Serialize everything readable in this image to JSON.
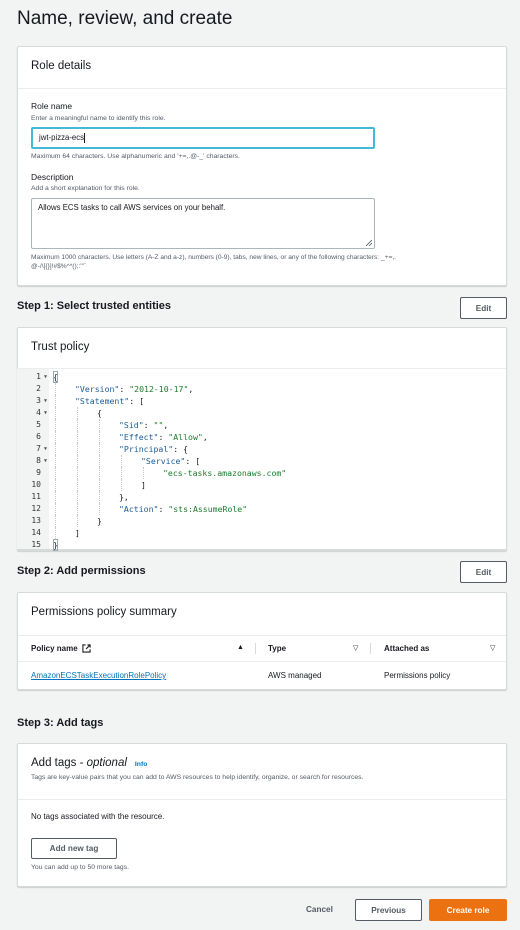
{
  "page": {
    "title": "Name, review, and create"
  },
  "role_details": {
    "header": "Role details",
    "role_name": {
      "label": "Role name",
      "hint": "Enter a meaningful name to identify this role.",
      "value": "jwt-pizza-ecs",
      "constraint": "Maximum 64 characters. Use alphanumeric and '+=,.@-_' characters."
    },
    "description": {
      "label": "Description",
      "hint": "Add a short explanation for this role.",
      "value": "Allows ECS tasks to call AWS services on your behalf.",
      "constraint_line1": "Maximum 1000 characters. Use letters (A-Z and a-z), numbers (0-9), tabs, new lines, or any of the following characters: _+=,.",
      "constraint_line2": "@-/\\[{}]!#$%^*();:\"'`"
    }
  },
  "step1": {
    "title": "Step 1: Select trusted entities",
    "edit_label": "Edit"
  },
  "trust_policy": {
    "header": "Trust policy",
    "lines": [
      {
        "n": "1",
        "fold": true
      },
      {
        "n": "2",
        "fold": false
      },
      {
        "n": "3",
        "fold": true
      },
      {
        "n": "4",
        "fold": true
      },
      {
        "n": "5",
        "fold": false
      },
      {
        "n": "6",
        "fold": false
      },
      {
        "n": "7",
        "fold": true
      },
      {
        "n": "8",
        "fold": true
      },
      {
        "n": "9",
        "fold": false
      },
      {
        "n": "10",
        "fold": false
      },
      {
        "n": "11",
        "fold": false
      },
      {
        "n": "12",
        "fold": false
      },
      {
        "n": "13",
        "fold": false
      },
      {
        "n": "14",
        "fold": false
      },
      {
        "n": "15",
        "fold": false
      }
    ],
    "tokens": {
      "version_key": "\"Version\"",
      "version_val": "\"2012-10-17\"",
      "statement_key": "\"Statement\"",
      "sid_key": "\"Sid\"",
      "sid_val": "\"\"",
      "effect_key": "\"Effect\"",
      "effect_val": "\"Allow\"",
      "principal_key": "\"Principal\"",
      "service_key": "\"Service\"",
      "service_val": "\"ecs-tasks.amazonaws.com\"",
      "action_key": "\"Action\"",
      "action_val": "\"sts:AssumeRole\""
    }
  },
  "step2": {
    "title": "Step 2: Add permissions",
    "edit_label": "Edit"
  },
  "permissions": {
    "header": "Permissions policy summary",
    "columns": {
      "policy_name": "Policy name",
      "type": "Type",
      "attached_as": "Attached as"
    },
    "rows": [
      {
        "policy_name": "AmazonECSTaskExecutionRolePolicy",
        "type": "AWS managed",
        "attached_as": "Permissions policy"
      }
    ]
  },
  "step3": {
    "title": "Step 3: Add tags"
  },
  "tags": {
    "header": "Add tags - ",
    "header_optional": "optional",
    "info_label": "Info",
    "description": "Tags are key-value pairs that you can add to AWS resources to help identify, organize, or search for resources.",
    "empty_text": "No tags associated with the resource.",
    "add_button": "Add new tag",
    "limit_text": "You can add up to 50 more tags."
  },
  "footer": {
    "cancel": "Cancel",
    "previous": "Previous",
    "create": "Create role"
  },
  "colors": {
    "accent": "#ec7211",
    "link": "#0073bb",
    "focus": "#44b9d6"
  }
}
